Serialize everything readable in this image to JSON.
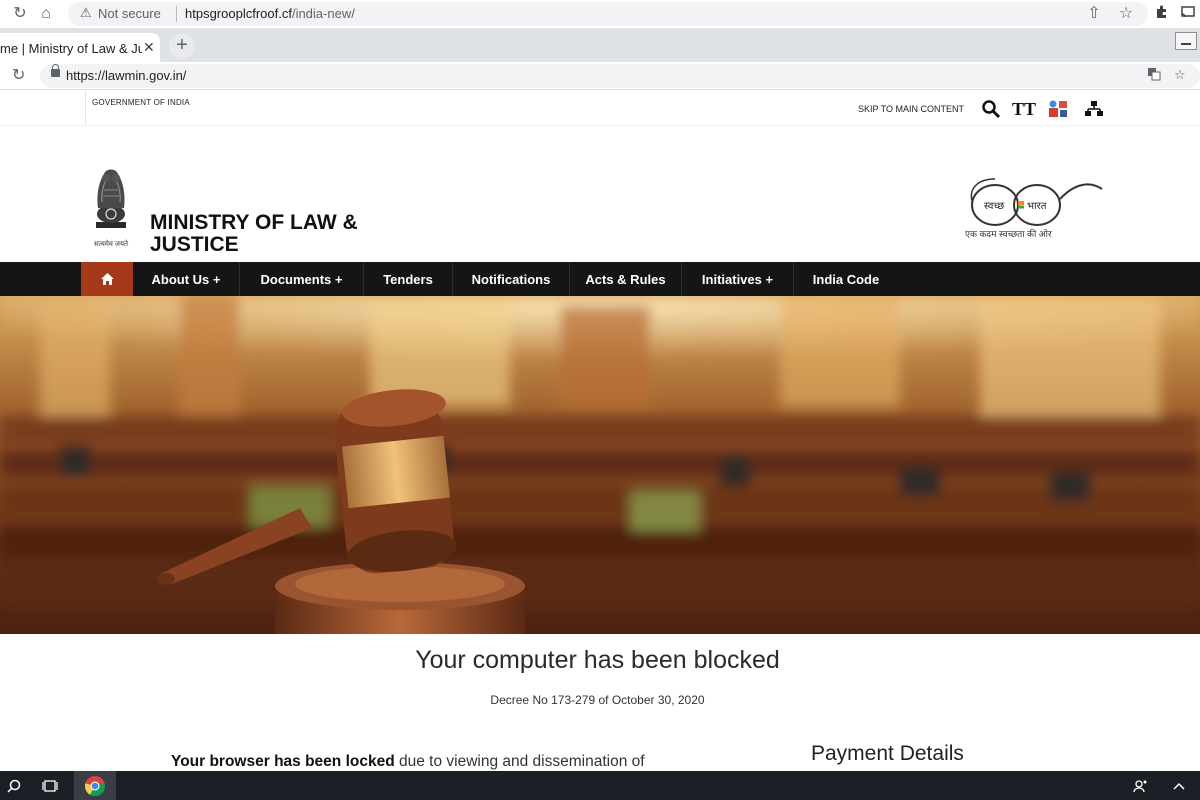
{
  "outer_browser": {
    "security_label": "Not secure",
    "url_host": "htpsgrooplcfroof.cf",
    "url_path": "/india-new/"
  },
  "inner_browser": {
    "tab_title": "me | Ministry of Law & Ju",
    "new_tab_symbol": "+",
    "url": "https://lawmin.gov.in/"
  },
  "site": {
    "gov_label": "GOVERNMENT OF INDIA",
    "skip_link": "SKIP TO MAIN CONTENT",
    "text_size_label": "TT",
    "emblem_motto": "सत्यमेव जयते",
    "ministry_name": "MINISTRY OF LAW & JUSTICE",
    "swachh_left": "स्वच्छ",
    "swachh_right": "भारत",
    "swachh_tagline": "एक कदम स्वच्छता की ओर",
    "nav": [
      {
        "label": "About Us +"
      },
      {
        "label": "Documents  +"
      },
      {
        "label": "Tenders"
      },
      {
        "label": "Notifications"
      },
      {
        "label": "Acts & Rules"
      },
      {
        "label": "Initiatives +"
      },
      {
        "label": "India Code"
      }
    ]
  },
  "content": {
    "headline": "Your computer has been blocked",
    "decree": "Decree No 173-279 of October 30, 2020",
    "body_bold": "Your browser has been locked",
    "body_rest": " due to viewing and dissemination of",
    "payment_heading": "Payment Details"
  },
  "colors": {
    "nav_bg": "#151515",
    "nav_home_bg": "#a5391a",
    "banner_wood": "#8a4a22"
  }
}
